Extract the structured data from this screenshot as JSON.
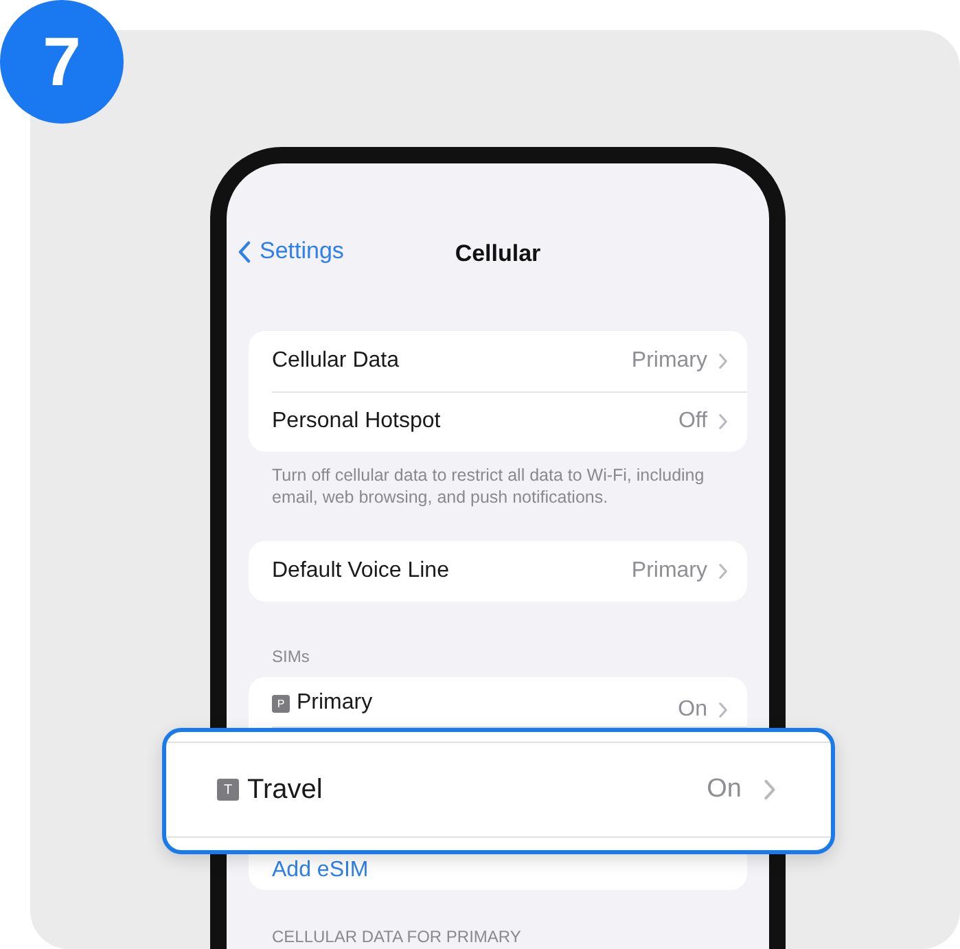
{
  "step": {
    "number": "7"
  },
  "nav": {
    "back": "Settings",
    "title": "Cellular"
  },
  "groups": [
    {
      "rows": [
        {
          "kind": "value",
          "label": "Cellular Data",
          "value": "Primary"
        },
        {
          "kind": "value",
          "label": "Personal Hotspot",
          "value": "Off"
        }
      ],
      "footer": "Turn off cellular data to restrict all data to Wi-Fi, including email, web browsing, and push notifications."
    },
    {
      "rows": [
        {
          "kind": "value",
          "label": "Default Voice Line",
          "value": "Primary"
        }
      ]
    },
    {
      "header": "SIMs",
      "rows": [
        {
          "kind": "sim",
          "badge": "P",
          "label": "Primary",
          "value": "On"
        },
        {
          "kind": "link",
          "label": "Add eSIM"
        }
      ]
    }
  ],
  "callout": {
    "kind": "sim",
    "badge": "T",
    "label": "Travel",
    "value": "On"
  },
  "next_header": "CELLULAR DATA FOR PRIMARY"
}
